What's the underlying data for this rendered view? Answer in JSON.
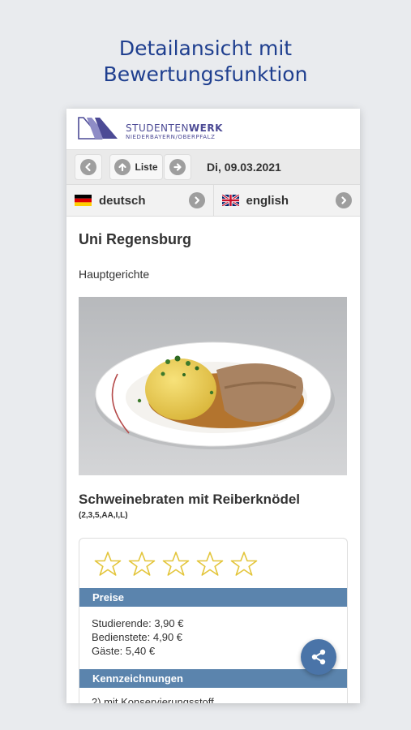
{
  "promo": {
    "line1": "Detailansicht mit",
    "line2": "Bewertungsfunktion"
  },
  "header": {
    "brand_light": "STUDENTEN",
    "brand_bold": "WERK",
    "brand_sub": "NIEDERBAYERN/OBERPFALZ"
  },
  "nav": {
    "list_label": "Liste",
    "date": "Di, 09.03.2021"
  },
  "languages": {
    "de_label": "deutsch",
    "en_label": "english"
  },
  "main": {
    "location": "Uni Regensburg",
    "category": "Hauptgerichte",
    "dish_name": "Schweinebraten mit Reiberknödel",
    "allergens": "(2,3,5,AA,I,L)",
    "rating": {
      "value": 0,
      "max": 5
    }
  },
  "prices": {
    "heading": "Preise",
    "students": "Studierende: 3,90 €",
    "staff": "Bedienstete: 4,90 €",
    "guests": "Gäste: 5,40 €"
  },
  "labels": {
    "heading": "Kennzeichnungen",
    "first_line": "2) mit Konservierungsstoff"
  },
  "colors": {
    "accent": "#5b84ad",
    "fab": "#4a74a8",
    "promo_title": "#1f3f8f",
    "brand": "#4c4a95",
    "star": "#e3c53a"
  },
  "icons": {
    "prev": "arrow-left-icon",
    "up": "arrow-up-icon",
    "next": "arrow-right-icon",
    "share": "share-icon"
  }
}
